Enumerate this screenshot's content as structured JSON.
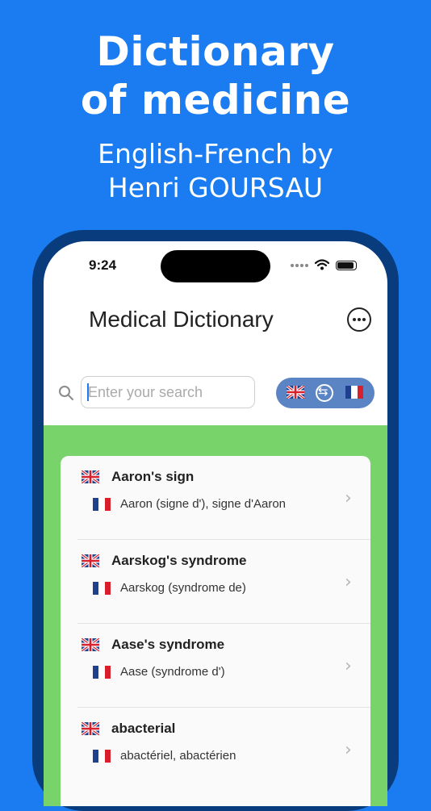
{
  "promo": {
    "title_line1": "Dictionary",
    "title_line2": "of medicine",
    "subtitle_line1": "English-French by",
    "subtitle_line2": "Henri GOURSAU"
  },
  "status_bar": {
    "time": "9:24"
  },
  "header": {
    "title": "Medical Dictionary",
    "menu_icon": "ellipsis-circle-icon"
  },
  "search": {
    "placeholder": "Enter your search",
    "value": ""
  },
  "language_toggle": {
    "from": "uk-flag-icon",
    "swap": "swap-icon",
    "to": "france-flag-icon"
  },
  "entries": [
    {
      "english": "Aaron's sign",
      "french": "Aaron (signe d'), signe d'Aaron"
    },
    {
      "english": "Aarskog's syndrome",
      "french": "Aarskog (syndrome de)"
    },
    {
      "english": "Aase's syndrome",
      "french": "Aase (syndrome d')"
    },
    {
      "english": "abacterial",
      "french": "abactériel, abactérien"
    }
  ],
  "colors": {
    "background": "#1a7cf0",
    "phone_frame": "#083c7d",
    "list_background": "#77d36a",
    "toggle": "#5b84c4"
  }
}
